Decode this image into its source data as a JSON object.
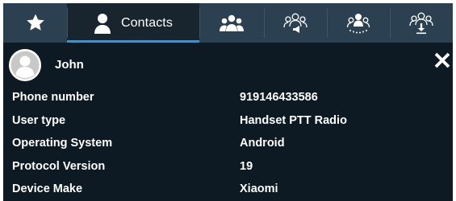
{
  "tabs": [
    {
      "icon": "star-icon",
      "label": "",
      "active": false
    },
    {
      "icon": "person-icon",
      "label": "Contacts",
      "active": true
    },
    {
      "icon": "group-icon",
      "label": "",
      "active": false
    },
    {
      "icon": "group-broadcast-icon",
      "label": "",
      "active": false
    },
    {
      "icon": "group-dispatch-icon",
      "label": "",
      "active": false
    },
    {
      "icon": "group-download-icon",
      "label": "",
      "active": false
    }
  ],
  "contact": {
    "name": "John",
    "avatar_icon": "avatar-icon",
    "close_icon": "close-icon"
  },
  "details": [
    {
      "label": "Phone number",
      "value": "919146433586"
    },
    {
      "label": "User type",
      "value": "Handset PTT Radio"
    },
    {
      "label": "Operating System",
      "value": "Android"
    },
    {
      "label": "Protocol Version",
      "value": "19"
    },
    {
      "label": "Device Make",
      "value": "Xiaomi"
    }
  ],
  "colors": {
    "background": "#0d1a23",
    "tabbar": "#2b4050",
    "active_tab": "#18242e",
    "active_indicator": "#4a8fc1",
    "text": "#ffffff"
  }
}
